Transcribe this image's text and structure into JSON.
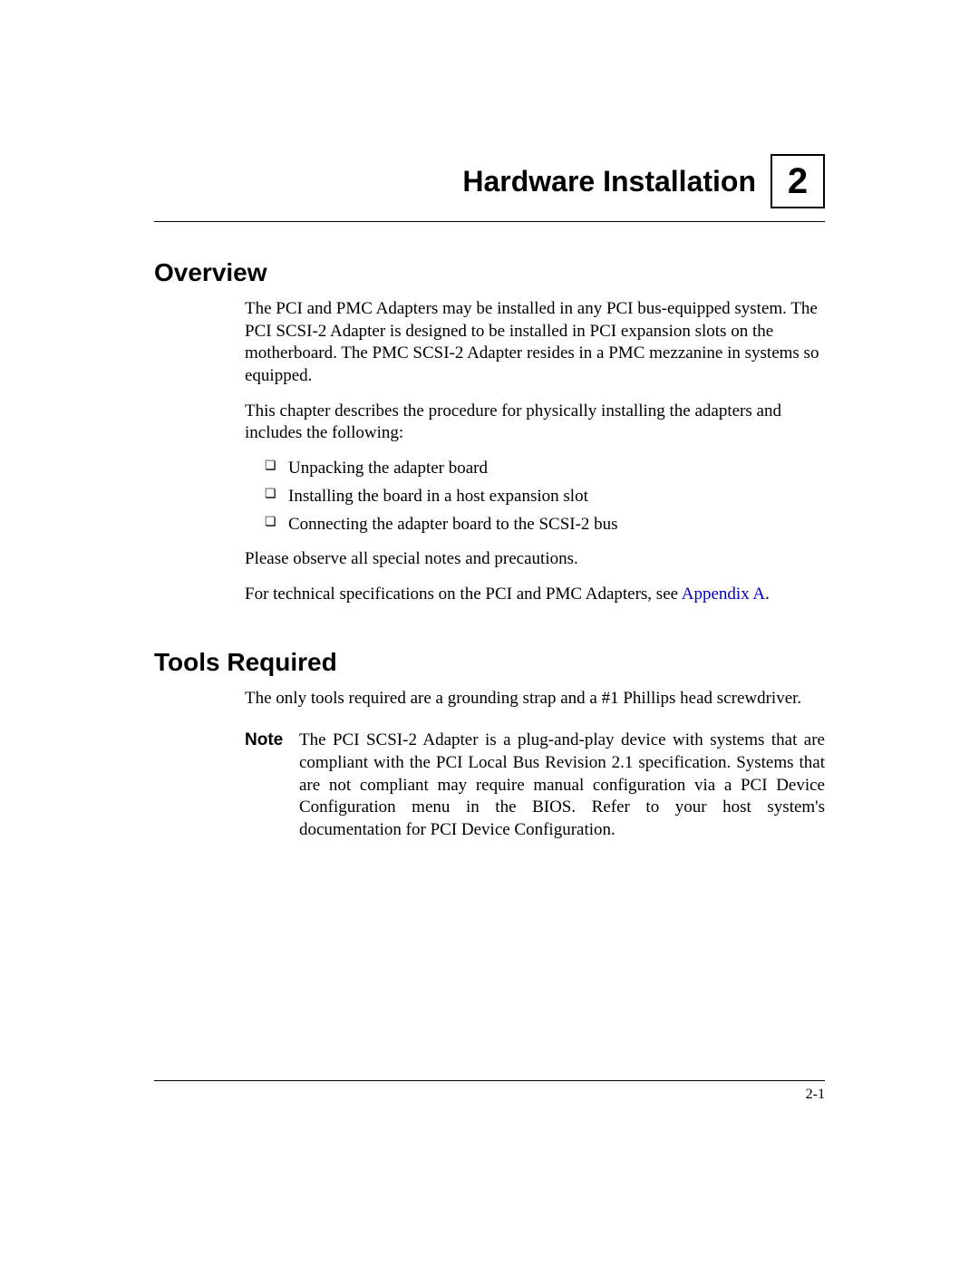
{
  "chapter": {
    "title": "Hardware Installation",
    "number": "2"
  },
  "sections": {
    "overview": {
      "heading": "Overview",
      "para1": "The PCI and PMC Adapters may be installed in any PCI bus-equipped system. The PCI SCSI-2 Adapter is designed to be installed in PCI expansion slots on the motherboard. The PMC SCSI-2 Adapter resides in a PMC mezzanine in systems so equipped.",
      "para2": "This chapter describes the procedure for physically installing the adapters and includes the following:",
      "bullets": [
        "Unpacking the adapter board",
        "Installing the board in a host expansion slot",
        "Connecting the adapter board to the SCSI-2 bus"
      ],
      "para3": "Please observe all special notes and precautions.",
      "para4_a": "For technical specifications on the PCI and PMC Adapters, see ",
      "para4_link": "Appendix A",
      "para4_b": "."
    },
    "tools": {
      "heading": "Tools Required",
      "para1": "The only tools required are a grounding strap and a #1 Phillips head screwdriver.",
      "note_label": "Note",
      "note_text": "The PCI SCSI-2 Adapter is a plug-and-play device with systems that are compliant with the PCI Local Bus Revision 2.1 specification. Systems that are not compliant may require manual configuration via a PCI Device Configuration menu in the BIOS. Refer to your host system's documentation for PCI Device Configuration."
    }
  },
  "footer": {
    "page_number": "2-1"
  }
}
